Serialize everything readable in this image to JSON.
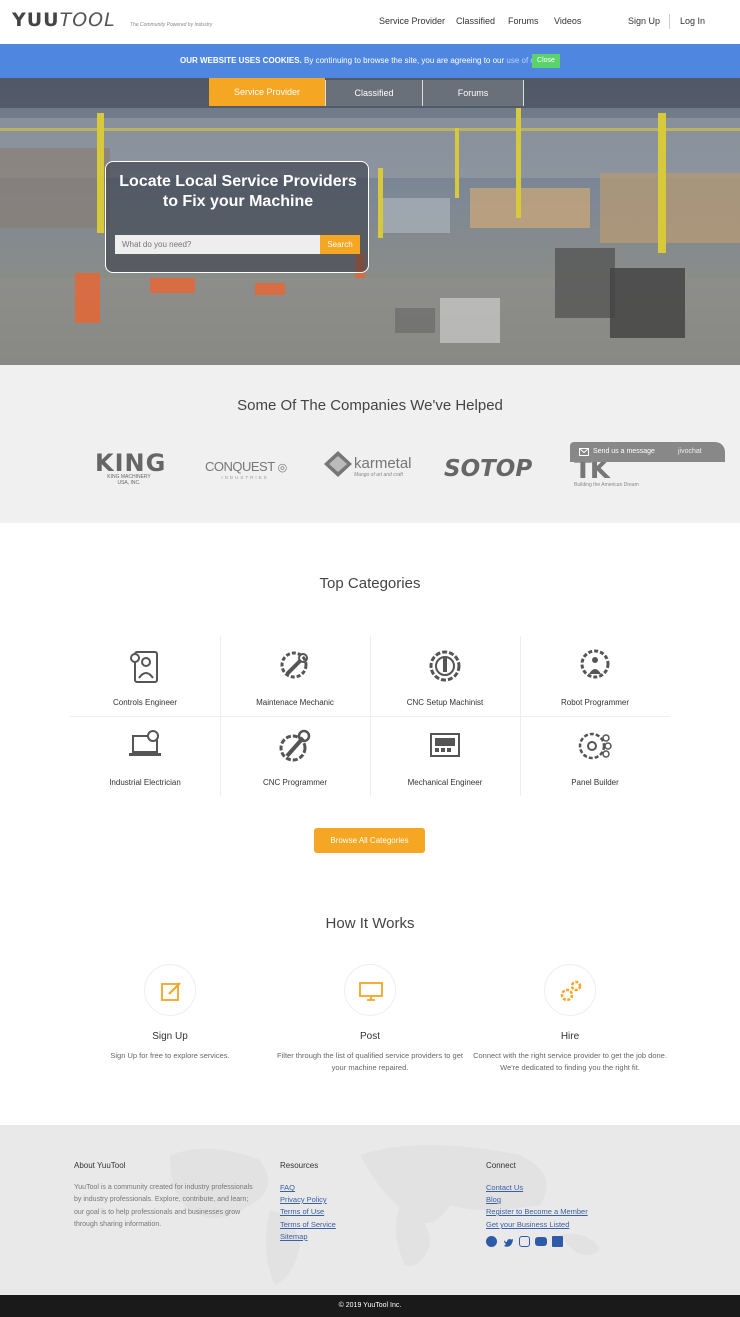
{
  "header": {
    "logo_bold": "YUU",
    "logo_light": "TOOL",
    "tagline": "The Community Powered by Industry",
    "nav": [
      "Service Provider",
      "Classified",
      "Forums",
      "Videos"
    ],
    "sign_up": "Sign Up",
    "log_in": "Log In"
  },
  "cookie": {
    "bold": "OUR WEBSITE USES COOKIES.",
    "text": "By continuing to browse the site, you are agreeing to our",
    "link": "use of cookies",
    "close": "Close"
  },
  "hero": {
    "tabs": [
      "Service Provider",
      "Classified",
      "Forums"
    ],
    "title_line1": "Locate Local Service Providers",
    "title_line2": "to Fix your Machine",
    "search_placeholder": "What do you need?",
    "search_button": "Search"
  },
  "companies": {
    "heading": "Some Of The Companies We've Helped",
    "logos": [
      {
        "name": "KING",
        "sub": "KING MACHINERY\nUSA, INC."
      },
      {
        "name": "CONQUEST",
        "sub": "INDUSTRIES"
      },
      {
        "name": "karmetal",
        "sub": "Mango of art and craft"
      },
      {
        "name": "SOTOP",
        "sub": ""
      },
      {
        "name": "TK",
        "sub": "Building the American Dream"
      }
    ],
    "chat_label": "Send us a message",
    "chat_brand": "jivochat"
  },
  "categories": {
    "heading": "Top Categories",
    "items": [
      "Controls Engineer",
      "Maintenace Mechanic",
      "CNC Setup Machinist",
      "Robot Programmer",
      "Industrial Electrician",
      "CNC Programmer",
      "Mechanical Engineer",
      "Panel Builder"
    ],
    "browse_button": "Browse All Categories"
  },
  "how": {
    "heading": "How It Works",
    "steps": [
      {
        "title": "Sign Up",
        "desc": "Sign Up for free to explore services."
      },
      {
        "title": "Post",
        "desc": "Filter through the list of qualified service providers to get your machine repaired."
      },
      {
        "title": "Hire",
        "desc": "Connect with the right service provider to get the job done. We're dedicated to finding you the right fit."
      }
    ]
  },
  "footer": {
    "about_title": "About YuuTool",
    "about_text": "YuuTool is a community created for industry professionals by industry professionals. Explore, contribute, and learn; our goal is to help professionals and businesses grow through sharing information.",
    "resources_title": "Resources",
    "resources": [
      "FAQ",
      "Privacy Policy",
      "Terms of Use",
      "Terms of Service",
      "Sitemap"
    ],
    "connect_title": "Connect",
    "connect": [
      "Contact Us",
      "Blog",
      "Register to Become a Member",
      "Get your Business Listed"
    ],
    "social_icons": [
      "facebook-icon",
      "twitter-icon",
      "instagram-icon",
      "youtube-icon",
      "linkedin-icon"
    ],
    "copyright": "© 2019 YuuTool Inc."
  },
  "colors": {
    "accent": "#f5a623",
    "cookie_bar": "#4f86e0",
    "link": "#3a5fa6"
  }
}
